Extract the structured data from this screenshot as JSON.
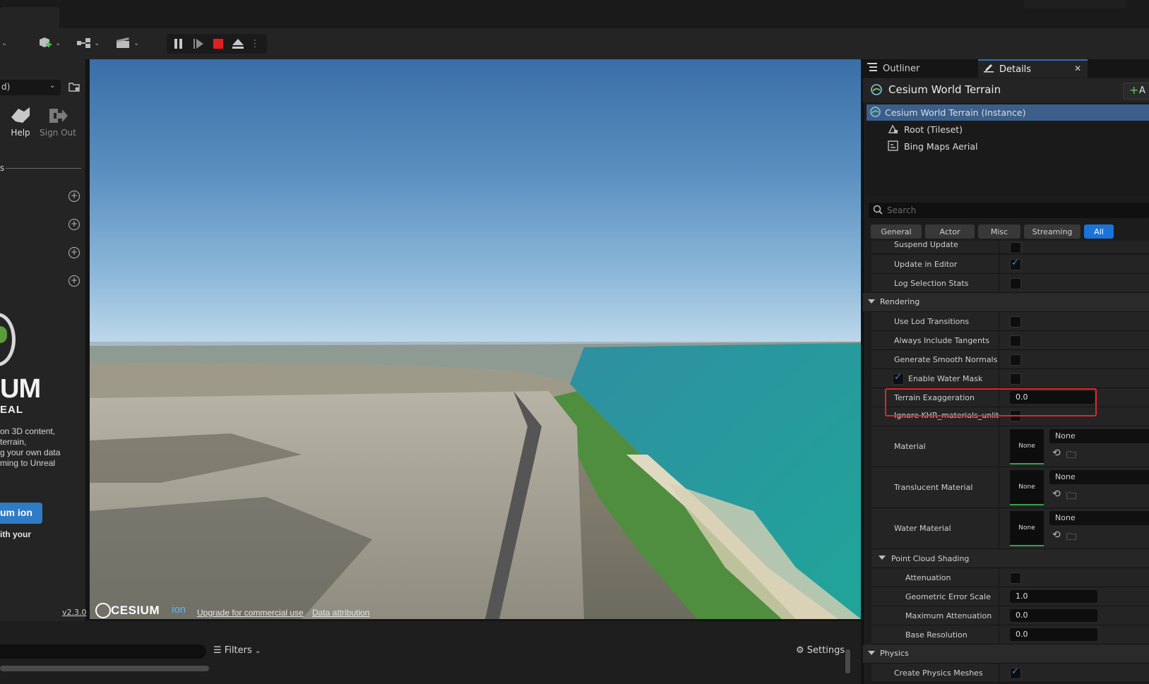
{
  "toolbar": {
    "icons": [
      "add-actor-icon",
      "blueprint-icon",
      "cinematics-icon"
    ],
    "play_controls": [
      "pause-icon",
      "frame-skip-icon",
      "stop-icon",
      "eject-icon",
      "more-options-icon"
    ]
  },
  "left_panel": {
    "select_value": "d)",
    "help_label": "Help",
    "sign_out_label": "Sign Out",
    "section_label": "s",
    "brand_big": "UM",
    "brand_sub": "EAL",
    "desc_lines": [
      "on 3D content,",
      "terrain,",
      "g your own data",
      "ming to Unreal"
    ],
    "ion_button_label": "um ion",
    "ion_sub": "ith your",
    "version": "v2.3.0"
  },
  "viewport": {
    "logo_text": "CESIUM",
    "logo_ion": "ion",
    "upgrade_link": "Upgrade for commercial use",
    "attribution_link": "Data attribution"
  },
  "right_panel": {
    "tabs": {
      "outliner": "Outliner",
      "details": "Details"
    },
    "actor_name": "Cesium World Terrain",
    "add_label": "A",
    "tree": [
      {
        "label": "Cesium World Terrain (Instance)",
        "selected": true
      },
      {
        "label": "Root (Tileset)",
        "selected": false
      },
      {
        "label": "Bing Maps Aerial",
        "selected": false
      }
    ],
    "search_placeholder": "Search",
    "filter_tabs": [
      "General",
      "Actor",
      "Misc",
      "Streaming",
      "All"
    ],
    "active_filter": "All",
    "props": {
      "suspend_update": "Suspend Update",
      "update_in_editor": "Update in Editor",
      "log_selection_stats": "Log Selection Stats",
      "rendering": "Rendering",
      "use_lod_transitions": "Use Lod Transitions",
      "always_include_tangents": "Always Include Tangents",
      "generate_smooth_normals": "Generate Smooth Normals",
      "enable_water_mask": "Enable Water Mask",
      "terrain_exaggeration": "Terrain Exaggeration",
      "terrain_exaggeration_value": "0.0",
      "ignore_khr": "Ignore KHR_materials_unlit",
      "material": "Material",
      "translucent_material": "Translucent Material",
      "water_material": "Water Material",
      "none": "None",
      "point_cloud_shading": "Point Cloud Shading",
      "attenuation": "Attenuation",
      "geometric_error_scale": "Geometric Error Scale",
      "geometric_error_scale_value": "1.0",
      "maximum_attenuation": "Maximum Attenuation",
      "maximum_attenuation_value": "0.0",
      "base_resolution": "Base Resolution",
      "base_resolution_value": "0.0",
      "physics": "Physics",
      "create_physics_meshes": "Create Physics Meshes"
    }
  },
  "bottom_bar": {
    "filters_label": "Filters",
    "settings_label": "Settings"
  },
  "colors": {
    "accent": "#1a73d9",
    "highlight": "#e0262a",
    "selection": "#3b5f8a"
  }
}
